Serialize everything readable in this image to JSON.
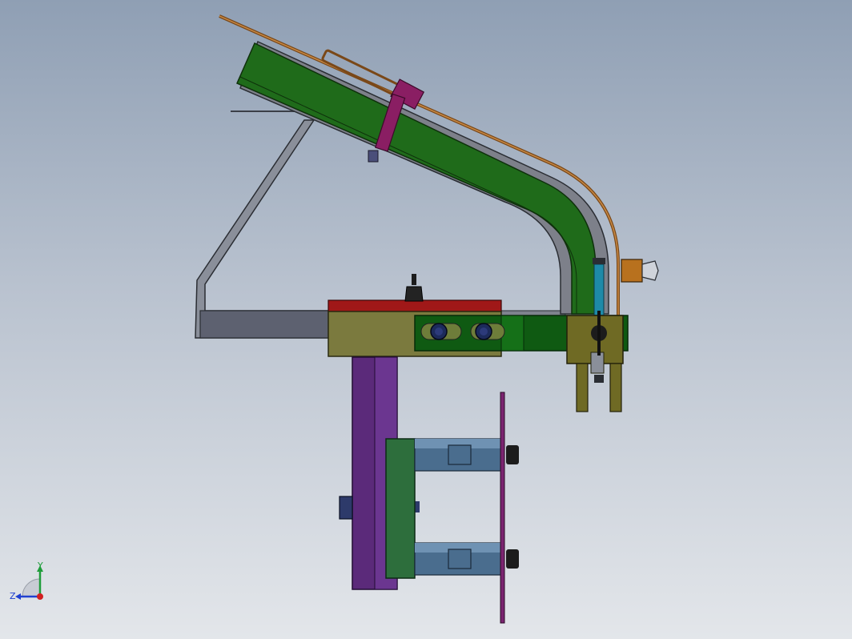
{
  "viewport": {
    "background_top": "#8f9fb4",
    "background_bottom": "#e3e6ea"
  },
  "model": {
    "description_parts": [
      "frame-bracket",
      "curved-chute",
      "guide-rail",
      "clamp-block",
      "mount-post",
      "cylinder-pair",
      "clevis-bracket"
    ],
    "colors": {
      "frame": "#5a5f6b",
      "chute": "#1f6b1a",
      "rail": "#b06a2a",
      "clamp": "#8a1e63",
      "top_plate": "#a01818",
      "block": "#7b7a3e",
      "mount_plate": "#0f5a12",
      "post": "#5b2a7a",
      "cylinder": "#4a6d8e",
      "base_plate": "#2d6e3c",
      "end_plate": "#7b2470",
      "clevis": "#6f6a24",
      "fitting": "#b8711e"
    }
  },
  "triad": {
    "y_label": "Y",
    "z_label": "Z",
    "y_color": "#1f9d3a",
    "x_color": "#d22020",
    "z_color": "#2040d0"
  }
}
